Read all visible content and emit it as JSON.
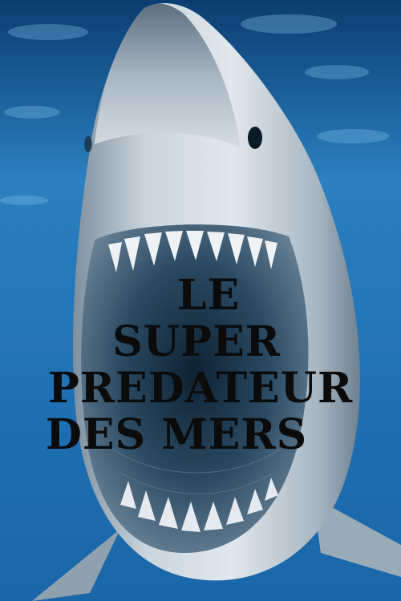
{
  "poster": {
    "title_lines": [
      "LE",
      "SUPER",
      "PREDATEUR",
      "DES MERS"
    ]
  },
  "colors": {
    "water_dark": "#0b4378",
    "water_light": "#2a7fbf",
    "shark_body": "#c9d3db",
    "mouth_dark": "#1f3447",
    "title_text": "#0b0b0b"
  }
}
